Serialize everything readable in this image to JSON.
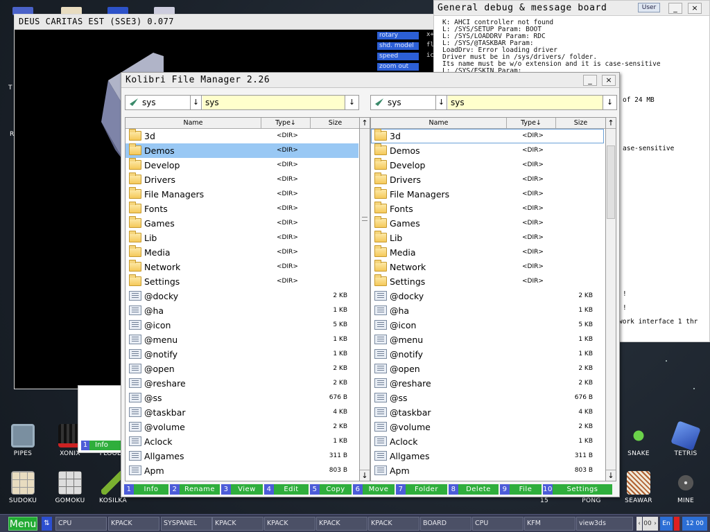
{
  "desktop": {
    "icons": [
      {
        "label": "PIPES",
        "color": "#7a8fa0"
      },
      {
        "label": "XONIX",
        "color": "#2a2a2a"
      },
      {
        "label": "FLOOD",
        "color": "#3a4a2a"
      },
      {
        "label": "SNAKE",
        "color": "#1a3a1a"
      },
      {
        "label": "TETRIS",
        "color": "#3a6ad0"
      },
      {
        "label": "SUDOKU",
        "color": "#d8c8a8"
      },
      {
        "label": "GOMOKU",
        "color": "#e0e0e0"
      },
      {
        "label": "KOSILKA",
        "color": "#3a4a1a"
      },
      {
        "label": "15",
        "color": "#2a2f3a"
      },
      {
        "label": "PONG",
        "color": "#2a2f3a"
      },
      {
        "label": "SEAWAR",
        "color": "#f0ece0"
      },
      {
        "label": "MINE",
        "color": "#808080"
      }
    ],
    "left_edge_letters": [
      "T",
      "R"
    ]
  },
  "demo_window": {
    "title": "DEUS CARITAS EST (SSE3) 0.077",
    "buttons": [
      {
        "label": "rotary",
        "value": "x+"
      },
      {
        "label": "shd. model",
        "value": "fl"
      },
      {
        "label": "speed",
        "value": "ic"
      },
      {
        "label": "zoom out",
        "value": ""
      }
    ]
  },
  "debug_board": {
    "title": "General debug & message board",
    "user_button": "User",
    "lines": [
      "K: AHCI controller not found",
      "L: /SYS/SETUP Param: BOOT",
      "L: /SYS/LOADDRV Param: RDC",
      "L: /SYS/@TASKBAR Param:",
      "LoadDrv: Error loading driver",
      "Driver must be in /sys/drivers/ folder.",
      "Its name must be w/o extension and it is case-sensitive",
      "L: /SYS/ESKIN Param:"
    ],
    "visible_fragments": [
      "of 24 MB",
      "ase-sensitive",
      "!",
      "!",
      "work interface 1 thr"
    ]
  },
  "small_window": {
    "info_num": "1",
    "info_label": "Info"
  },
  "file_manager": {
    "title": "Kolibri File Manager 2.26",
    "min_button": "_",
    "close_button": "×",
    "left": {
      "drive": "sys",
      "path": "sys",
      "columns": {
        "name": "Name",
        "type": "Type↓",
        "size": "Size"
      },
      "sort_arrow": "↑"
    },
    "right": {
      "drive": "sys",
      "path": "sys",
      "columns": {
        "name": "Name",
        "type": "Type↓",
        "size": "Size"
      },
      "sort_arrow": "↑"
    },
    "files": [
      {
        "name": "3d",
        "type": "<DIR>",
        "size": "",
        "kind": "folder"
      },
      {
        "name": "Demos",
        "type": "<DIR>",
        "size": "",
        "kind": "folder"
      },
      {
        "name": "Develop",
        "type": "<DIR>",
        "size": "",
        "kind": "folder"
      },
      {
        "name": "Drivers",
        "type": "<DIR>",
        "size": "",
        "kind": "folder"
      },
      {
        "name": "File Managers",
        "type": "<DIR>",
        "size": "",
        "kind": "folder"
      },
      {
        "name": "Fonts",
        "type": "<DIR>",
        "size": "",
        "kind": "folder"
      },
      {
        "name": "Games",
        "type": "<DIR>",
        "size": "",
        "kind": "folder"
      },
      {
        "name": "Lib",
        "type": "<DIR>",
        "size": "",
        "kind": "folder"
      },
      {
        "name": "Media",
        "type": "<DIR>",
        "size": "",
        "kind": "folder"
      },
      {
        "name": "Network",
        "type": "<DIR>",
        "size": "",
        "kind": "folder"
      },
      {
        "name": "Settings",
        "type": "<DIR>",
        "size": "",
        "kind": "folder"
      },
      {
        "name": "@docky",
        "type": "",
        "size": "2 KB",
        "kind": "file"
      },
      {
        "name": "@ha",
        "type": "",
        "size": "1 KB",
        "kind": "file"
      },
      {
        "name": "@icon",
        "type": "",
        "size": "5 KB",
        "kind": "file"
      },
      {
        "name": "@menu",
        "type": "",
        "size": "1 KB",
        "kind": "file"
      },
      {
        "name": "@notify",
        "type": "",
        "size": "1 KB",
        "kind": "file"
      },
      {
        "name": "@open",
        "type": "",
        "size": "2 KB",
        "kind": "file"
      },
      {
        "name": "@reshare",
        "type": "",
        "size": "2 KB",
        "kind": "file"
      },
      {
        "name": "@ss",
        "type": "",
        "size": "676 B",
        "kind": "file"
      },
      {
        "name": "@taskbar",
        "type": "",
        "size": "4 KB",
        "kind": "file"
      },
      {
        "name": "@volume",
        "type": "",
        "size": "2 KB",
        "kind": "file"
      },
      {
        "name": "Aclock",
        "type": "",
        "size": "1 KB",
        "kind": "file"
      },
      {
        "name": "Allgames",
        "type": "",
        "size": "311 B",
        "kind": "file"
      },
      {
        "name": "Apm",
        "type": "",
        "size": "803 B",
        "kind": "file"
      }
    ],
    "left_selected_index": 1,
    "right_cursor_index": 0,
    "fkeys": [
      {
        "num": "1",
        "label": "Info"
      },
      {
        "num": "2",
        "label": "Rename"
      },
      {
        "num": "3",
        "label": "View"
      },
      {
        "num": "4",
        "label": "Edit"
      },
      {
        "num": "5",
        "label": "Copy"
      },
      {
        "num": "6",
        "label": "Move"
      },
      {
        "num": "7",
        "label": "Folder"
      },
      {
        "num": "8",
        "label": "Delete"
      },
      {
        "num": "9",
        "label": "File"
      },
      {
        "num": "10",
        "label": "Settings"
      }
    ]
  },
  "taskbar": {
    "menu_label": "Menu",
    "switch_icon": "⇅",
    "tasks": [
      "CPU",
      "KPACK",
      "SYSPANEL",
      "KPACK",
      "KPACK",
      "KPACK",
      "KPACK",
      "BOARD",
      "CPU",
      "KFM",
      "view3ds"
    ],
    "lang": "En",
    "clock": "12 00",
    "counter": "00"
  }
}
